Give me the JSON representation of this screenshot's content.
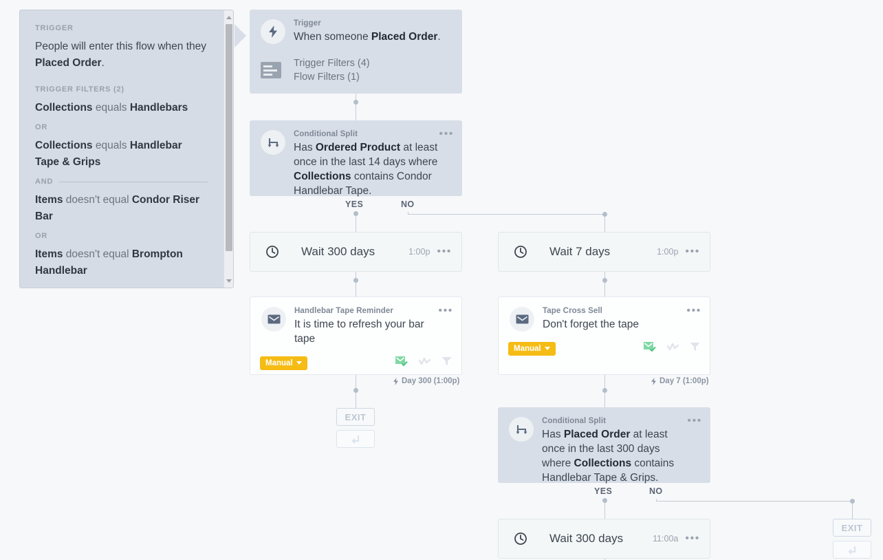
{
  "sidebar": {
    "trigger_label": "TRIGGER",
    "trigger_text_prefix": "People will enter this flow when they ",
    "trigger_text_bold": "Placed Order",
    "trigger_text_suffix": ".",
    "filters_label": "TRIGGER FILTERS (2)",
    "conditions": [
      {
        "field": "Collections",
        "op": " equals ",
        "value": "Handlebars",
        "joiner": "OR",
        "joiner_rule": false
      },
      {
        "field": "Collections",
        "op": " equals ",
        "value": "Handlebar Tape & Grips",
        "joiner": "AND",
        "joiner_rule": true
      },
      {
        "field": "Items",
        "op": " doesn't equal ",
        "value": "Condor Riser Bar",
        "joiner": "OR",
        "joiner_rule": false
      },
      {
        "field": "Items",
        "op": " doesn't equal ",
        "value": "Brompton Handlebar",
        "joiner": "",
        "joiner_rule": false
      }
    ]
  },
  "nodes": {
    "trigger": {
      "kicker": "Trigger",
      "text_prefix": "When someone ",
      "text_bold": "Placed Order",
      "text_suffix": ".",
      "trigger_filters": "Trigger Filters (4)",
      "flow_filters": "Flow Filters (1)",
      "icon": "lightning-bolt-icon",
      "filter_icon": "filter-list-icon"
    },
    "split1": {
      "kicker": "Conditional Split",
      "text_1": "Has ",
      "text_bold_1": "Ordered Product",
      "text_2": " at least once in the last 14 days where ",
      "text_bold_2": "Collections",
      "text_3": " contains Condor Handlebar Tape.",
      "menu": "•••",
      "yes_label": "YES",
      "no_label": "NO",
      "icon": "split-branch-icon"
    },
    "wait_yes": {
      "title": "Wait 300 days",
      "time": "1:00p",
      "menu": "•••",
      "icon": "clock-icon"
    },
    "wait_no": {
      "title": "Wait 7 days",
      "time": "1:00p",
      "menu": "•••",
      "icon": "clock-icon"
    },
    "email_left": {
      "kicker": "Handlebar Tape Reminder",
      "subject": "It is time to refresh your bar tape",
      "pill": "Manual",
      "menu": "•••",
      "daystamp": "Day 300 (1:00p)",
      "icon": "envelope-icon",
      "status_icons": [
        "email-sent-icon",
        "analytics-icon",
        "filter-icon"
      ]
    },
    "email_right": {
      "kicker": "Tape Cross Sell",
      "subject": "Don't forget the tape",
      "pill": "Manual",
      "menu": "•••",
      "daystamp": "Day 7 (1:00p)",
      "icon": "envelope-icon",
      "status_icons": [
        "email-sent-icon",
        "analytics-icon",
        "filter-icon"
      ]
    },
    "split2": {
      "kicker": "Conditional Split",
      "text_1": "Has ",
      "text_bold_1": "Placed Order",
      "text_2": " at least once in the last 300 days where ",
      "text_bold_2": "Collections",
      "text_3": " contains Handlebar Tape & Grips.",
      "menu": "•••",
      "yes_label": "YES",
      "no_label": "NO",
      "icon": "split-branch-icon"
    },
    "wait_bottom": {
      "title": "Wait 300 days",
      "time": "11:00a",
      "menu": "•••",
      "icon": "clock-icon"
    },
    "exit_left": {
      "label": "EXIT"
    },
    "exit_right": {
      "label": "EXIT"
    }
  },
  "colors": {
    "canvas": "#f7f8fa",
    "card_shaded": "#d8dee7",
    "connector": "#c3cbd6",
    "pill_yellow": "#f5bc14",
    "sent_green": "#7fd9a4"
  }
}
